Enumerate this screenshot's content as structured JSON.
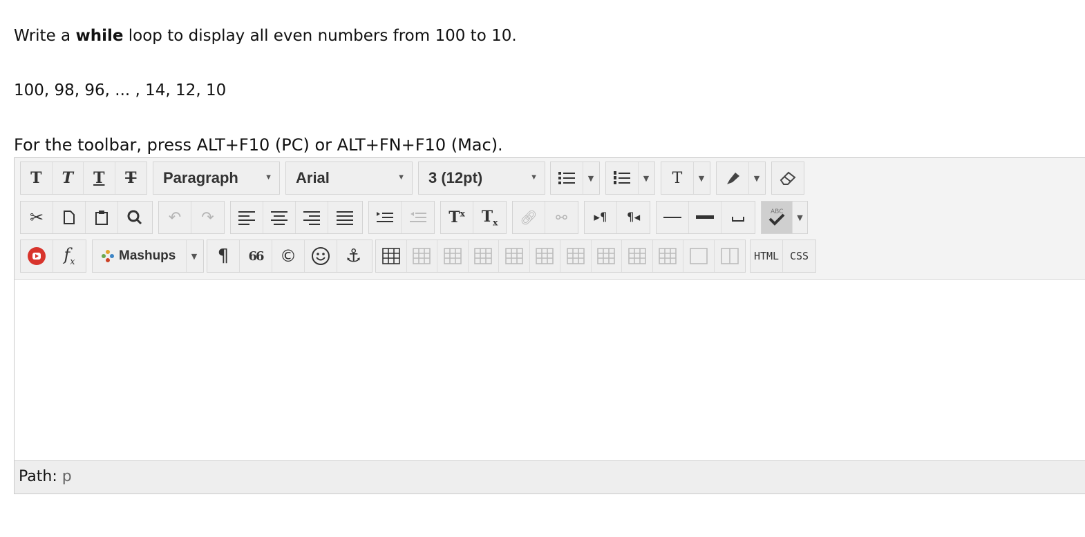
{
  "question": {
    "prefix": "Write a ",
    "keyword": "while",
    "suffix": " loop to display all even numbers from 100 to 10.",
    "sequence": "100, 98, 96, ... , 14, 12, 10",
    "toolbar_hint": "For the toolbar, press ALT+F10 (PC) or ALT+FN+F10 (Mac)."
  },
  "editor": {
    "format_select": "Paragraph",
    "font_select": "Arial",
    "size_select": "3 (12pt)",
    "mashups_label": "Mashups",
    "html_label": "HTML",
    "css_label": "CSS",
    "path_label": "Path:",
    "path_value": "p",
    "text_glyph": "T",
    "subscript_glyph": "x",
    "quote_glyph": "66",
    "copyright_glyph": "©",
    "pilcrow_glyph": "¶",
    "spell_glyph": "ABC"
  }
}
